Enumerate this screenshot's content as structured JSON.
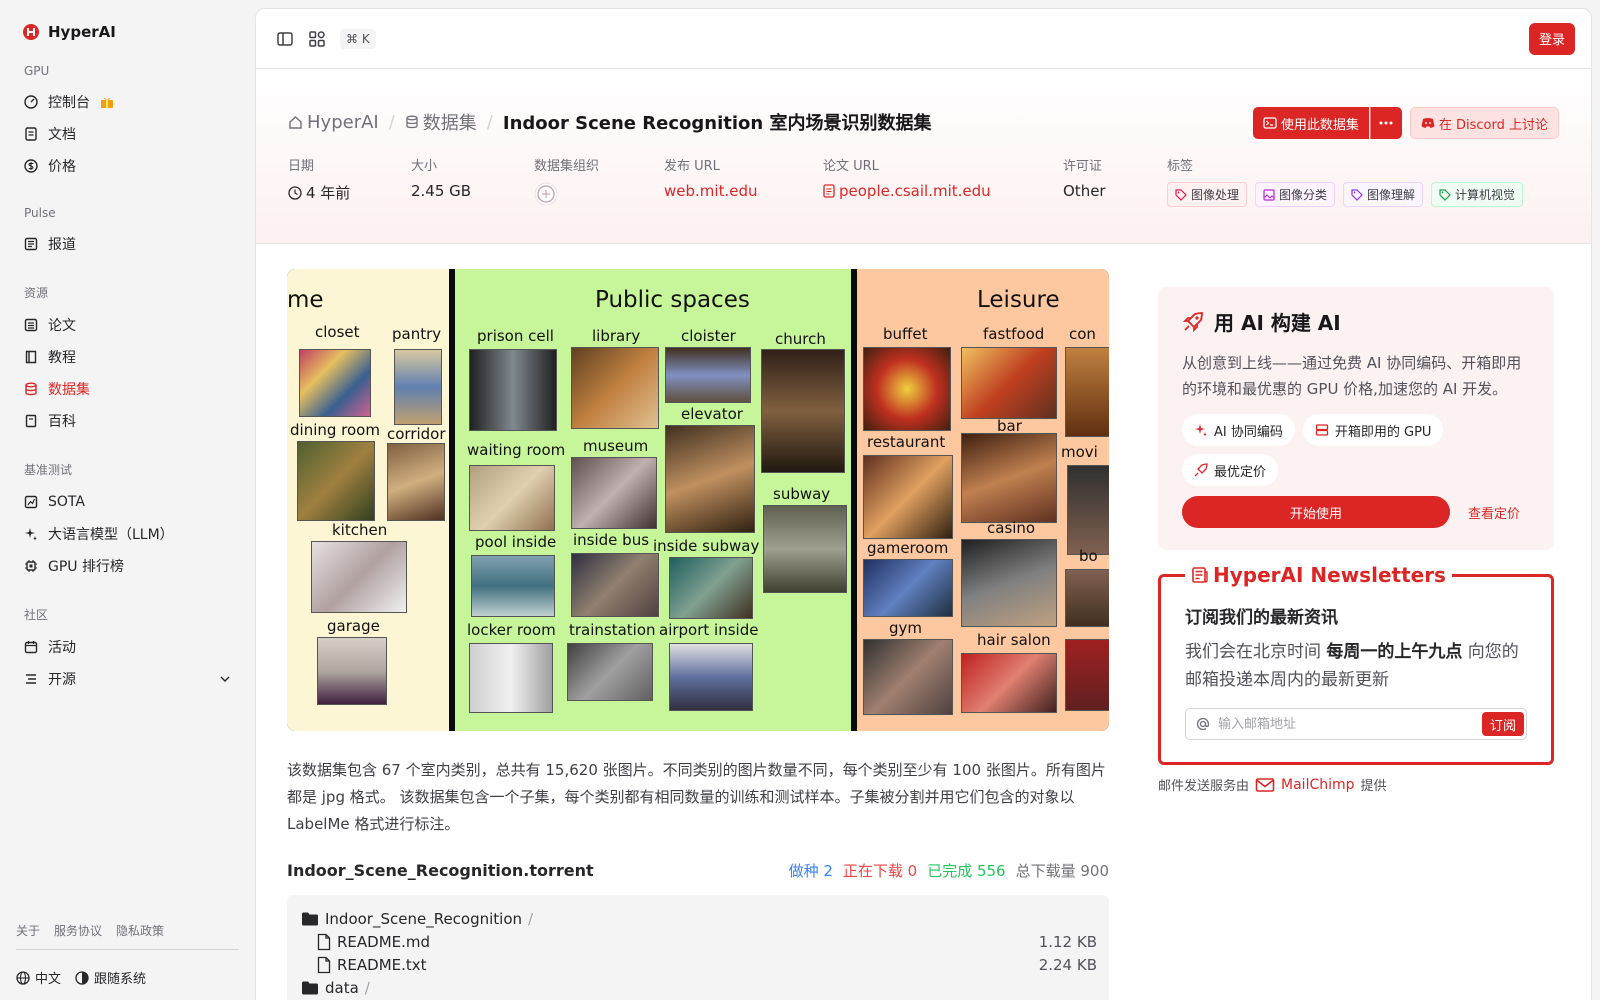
{
  "brand": {
    "name": "HyperAI"
  },
  "sidebar": {
    "groups": [
      {
        "label": "GPU",
        "items": [
          {
            "label": "控制台"
          },
          {
            "label": "文档"
          },
          {
            "label": "价格"
          }
        ]
      },
      {
        "label": "Pulse",
        "items": [
          {
            "label": "报道"
          }
        ]
      },
      {
        "label": "资源",
        "items": [
          {
            "label": "论文"
          },
          {
            "label": "教程"
          },
          {
            "label": "数据集",
            "active": true
          },
          {
            "label": "百科"
          }
        ]
      },
      {
        "label": "基准测试",
        "items": [
          {
            "label": "SOTA"
          },
          {
            "label": "大语言模型（LLM）"
          },
          {
            "label": "GPU 排行榜"
          }
        ]
      },
      {
        "label": "社区",
        "items": [
          {
            "label": "活动"
          },
          {
            "label": "开源"
          }
        ]
      }
    ],
    "footer_links": [
      "关于",
      "服务协议",
      "隐私政策"
    ],
    "language": "中文",
    "theme": "跟随系统"
  },
  "topbar": {
    "shortcut": "⌘ K",
    "login": "登录"
  },
  "breadcrumb": {
    "home": "HyperAI",
    "section": "数据集",
    "current": "Indoor Scene Recognition 室内场景识别数据集"
  },
  "actions": {
    "use_dataset": "使用此数据集",
    "discord": "在 Discord 上讨论"
  },
  "meta": {
    "date_label": "日期",
    "date_value": "4 年前",
    "size_label": "大小",
    "size_value": "2.45 GB",
    "org_label": "数据集组织",
    "publish_label": "发布 URL",
    "publish_value": "web.mit.edu",
    "paper_label": "论文 URL",
    "paper_value": "people.csail.mit.edu",
    "license_label": "许可证",
    "license_value": "Other",
    "tags_label": "标签",
    "tags": [
      "图像处理",
      "图像分类",
      "图像理解",
      "计算机视觉"
    ]
  },
  "hero_image": {
    "panels": [
      "me",
      "Public spaces",
      "Leisure"
    ],
    "labels": {
      "p1": [
        "closet",
        "pantry",
        "dining room",
        "corridor",
        "kitchen",
        "garage"
      ],
      "p2": [
        "prison cell",
        "library",
        "cloister",
        "church",
        "elevator",
        "waiting room",
        "museum",
        "subway",
        "pool inside",
        "inside bus",
        "inside subway",
        "locker room",
        "trainstation",
        "airport inside"
      ],
      "p3": [
        "buffet",
        "fastfood",
        "con",
        "bar",
        "restaurant",
        "movi",
        "casino",
        "gameroom",
        "bo",
        "gym",
        "hair salon"
      ]
    }
  },
  "description": "该数据集包含 67 个室内类别，总共有 15,620 张图片。不同类别的图片数量不同，每个类别至少有 100 张图片。所有图片都是 jpg 格式。 该数据集包含一个子集，每个类别都有相同数量的训练和测试样本。子集被分割并用它们包含的对象以 LabelMe 格式进行标注。",
  "torrent": {
    "name": "Indoor_Scene_Recognition.torrent",
    "seeding": "做种 2",
    "downloading": "正在下载 0",
    "completed": "已完成 556",
    "total": "总下载量 900",
    "files": [
      {
        "name": "Indoor_Scene_Recognition",
        "type": "folder",
        "size": ""
      },
      {
        "name": "README.md",
        "type": "file",
        "size": "1.12 KB"
      },
      {
        "name": "README.txt",
        "type": "file",
        "size": "2.24 KB"
      },
      {
        "name": "data",
        "type": "folder",
        "size": ""
      }
    ]
  },
  "ai_card": {
    "title": "用 AI 构建 AI",
    "desc": "从创意到上线——通过免费 AI 协同编码、开箱即用的环境和最优惠的 GPU 价格,加速您的 AI 开发。",
    "chips": [
      "AI 协同编码",
      "开箱即用的 GPU",
      "最优定价"
    ],
    "start": "开始使用",
    "pricing": "查看定价"
  },
  "newsletter": {
    "legend": "HyperAI Newsletters",
    "title": "订阅我们的最新资讯",
    "text_pre": "我们会在北京时间 ",
    "text_bold": "每周一的上午九点",
    "text_post": " 向您的邮箱投递本周内的最新更新",
    "placeholder": "输入邮箱地址",
    "subscribe": "订阅",
    "note_pre": "邮件发送服务由",
    "mailchimp": "MailChimp",
    "note_post": "提供"
  },
  "colors": {
    "accent": "#dc2626",
    "sidebar_bg": "#f4f4f5"
  }
}
